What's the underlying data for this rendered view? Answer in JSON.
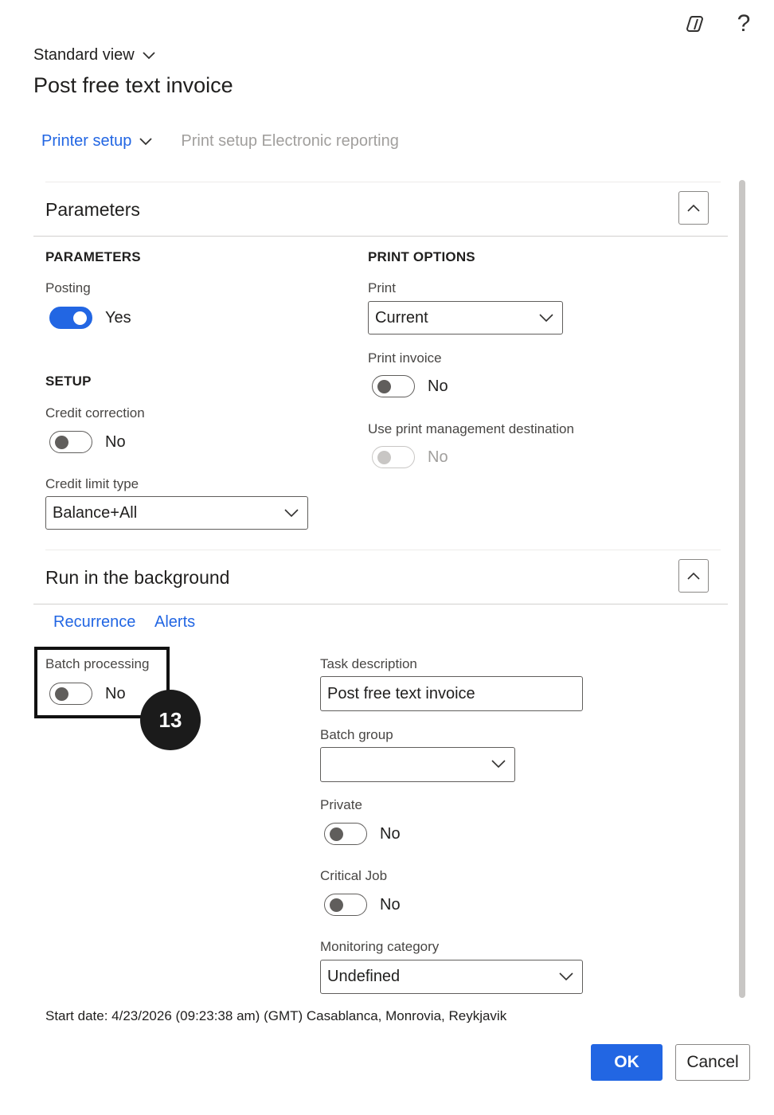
{
  "header": {
    "copilot_icon": "copilot-icon",
    "help_label": "?",
    "view_label": "Standard view",
    "title": "Post free text invoice"
  },
  "toolbar": {
    "printer_setup": "Printer setup",
    "print_setup_er": "Print setup Electronic reporting"
  },
  "parameters_section": {
    "title": "Parameters",
    "parameters_group": "PARAMETERS",
    "posting_label": "Posting",
    "posting_value": "Yes",
    "setup_group": "SETUP",
    "credit_correction_label": "Credit correction",
    "credit_correction_value": "No",
    "credit_limit_type_label": "Credit limit type",
    "credit_limit_type_value": "Balance+All",
    "print_options_group": "PRINT OPTIONS",
    "print_label": "Print",
    "print_value": "Current",
    "print_invoice_label": "Print invoice",
    "print_invoice_value": "No",
    "use_print_mgmt_label": "Use print management destination",
    "use_print_mgmt_value": "No"
  },
  "background_section": {
    "title": "Run in the background",
    "tab_recurrence": "Recurrence",
    "tab_alerts": "Alerts",
    "batch_processing_label": "Batch processing",
    "batch_processing_value": "No",
    "task_description_label": "Task description",
    "task_description_value": "Post free text invoice",
    "batch_group_label": "Batch group",
    "batch_group_value": "",
    "private_label": "Private",
    "private_value": "No",
    "critical_job_label": "Critical Job",
    "critical_job_value": "No",
    "monitoring_category_label": "Monitoring category",
    "monitoring_category_value": "Undefined"
  },
  "annotation": {
    "step_number": "13"
  },
  "footer": {
    "start_date": "Start date: 4/23/2026 (09:23:38 am) (GMT) Casablanca, Monrovia, Reykjavik",
    "ok_label": "OK",
    "cancel_label": "Cancel"
  },
  "colors": {
    "accent": "#2266e3",
    "text": "#201f1e",
    "disabled": "#a19f9d"
  }
}
